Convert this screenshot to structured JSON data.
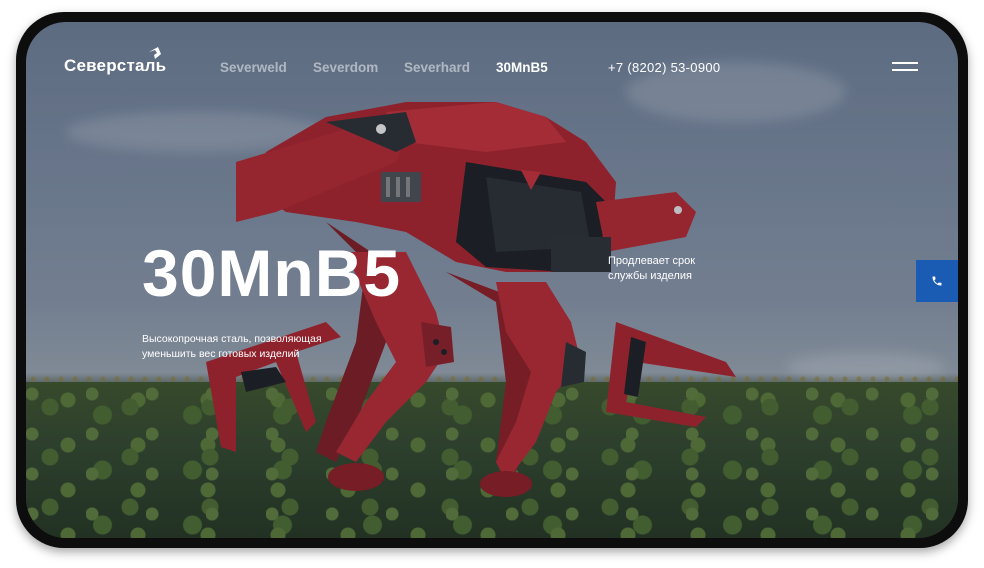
{
  "header": {
    "logo_text": "Северсталь",
    "nav": [
      {
        "label": "Severweld",
        "active": false
      },
      {
        "label": "Severdom",
        "active": false
      },
      {
        "label": "Severhard",
        "active": false
      },
      {
        "label": "30MnB5",
        "active": true
      }
    ],
    "phone": "+7 (8202) 53-0900",
    "menu_icon": "hamburger-menu-icon"
  },
  "hero": {
    "title": "30MnB5",
    "description": "Высокопрочная сталь, позволяющая уменьшить вес готовых изделий",
    "side_note": "Продлевает срок службы изделия"
  },
  "call_button": {
    "icon": "phone-icon",
    "color": "#1a5bb3"
  },
  "colors": {
    "robot_red": "#b0262c",
    "accent_blue": "#1a5bb3"
  }
}
